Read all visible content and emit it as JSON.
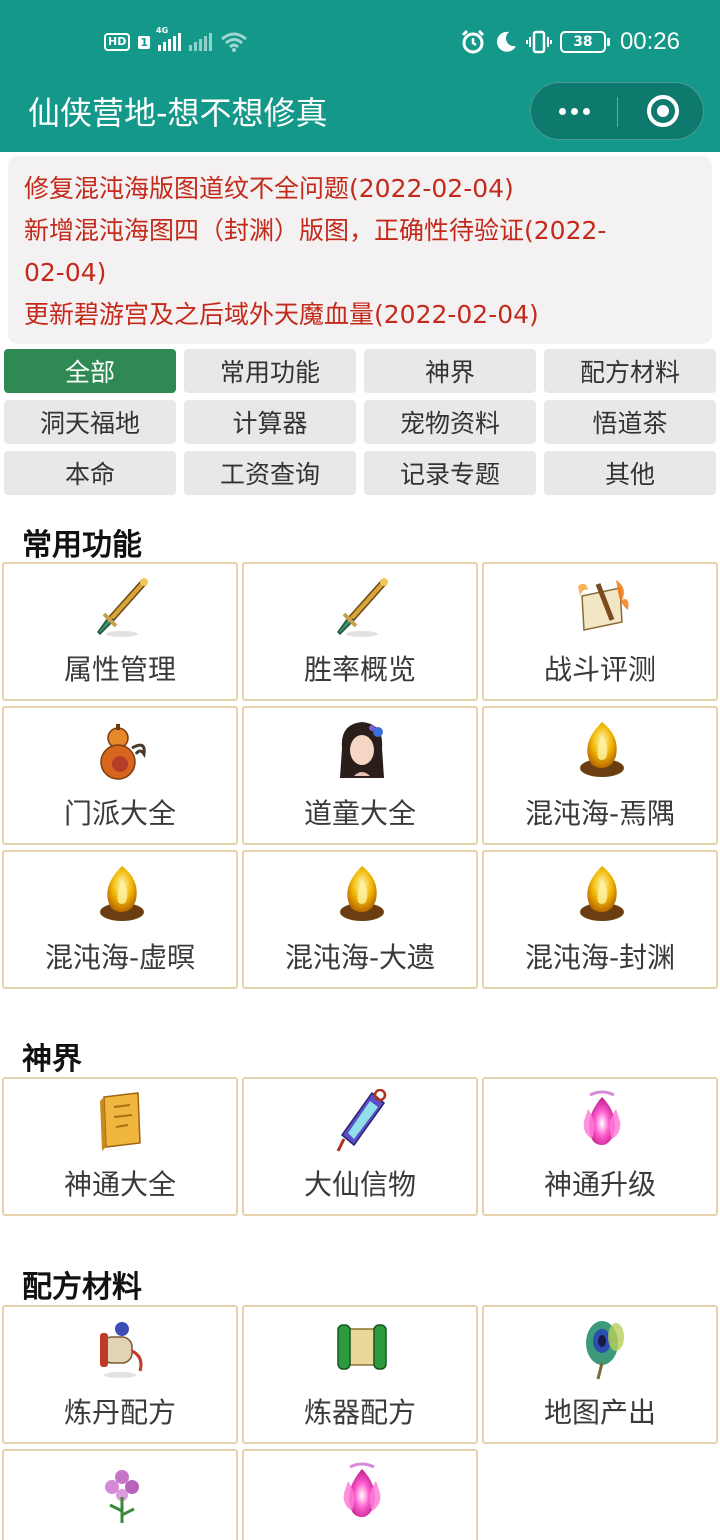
{
  "status_bar": {
    "hd": "HD",
    "sim": "1",
    "net": "4G",
    "battery": "38",
    "time": "00:26"
  },
  "header": {
    "title": "仙侠营地-想不想修真"
  },
  "notices": [
    "修复混沌海版图道纹不全问题(2022-02-04)",
    "新增混沌海图四（封渊）版图，正确性待验证(2022-",
    "02-04)",
    "更新碧游宫及之后域外天魔血量(2022-02-04)"
  ],
  "filters": [
    "全部",
    "常用功能",
    "神界",
    "配方材料",
    "洞天福地",
    "计算器",
    "宠物资料",
    "悟道茶",
    "本命",
    "工资查询",
    "记录专题",
    "其他"
  ],
  "sections": {
    "common": {
      "title": "常用功能",
      "items": [
        {
          "label": "属性管理",
          "icon": "sword-icon"
        },
        {
          "label": "胜率概览",
          "icon": "sword-icon"
        },
        {
          "label": "战斗评测",
          "icon": "scroll-fire-icon"
        },
        {
          "label": "门派大全",
          "icon": "gourd-icon"
        },
        {
          "label": "道童大全",
          "icon": "girl-portrait-icon"
        },
        {
          "label": "混沌海-焉隅",
          "icon": "golden-flame-icon"
        },
        {
          "label": "混沌海-虚暝",
          "icon": "golden-flame-icon"
        },
        {
          "label": "混沌海-大遗",
          "icon": "golden-flame-icon"
        },
        {
          "label": "混沌海-封渊",
          "icon": "golden-flame-icon"
        }
      ]
    },
    "divine": {
      "title": "神界",
      "items": [
        {
          "label": "神通大全",
          "icon": "book-icon"
        },
        {
          "label": "大仙信物",
          "icon": "talisman-icon"
        },
        {
          "label": "神通升级",
          "icon": "pink-flame-icon"
        }
      ]
    },
    "recipes": {
      "title": "配方材料",
      "items": [
        {
          "label": "炼丹配方",
          "icon": "elixir-scroll-icon"
        },
        {
          "label": "炼器配方",
          "icon": "green-scroll-icon"
        },
        {
          "label": "地图产出",
          "icon": "peacock-feather-icon"
        },
        {
          "label": "",
          "icon": "flower-icon"
        },
        {
          "label": "",
          "icon": "pink-flame-icon"
        }
      ]
    }
  }
}
